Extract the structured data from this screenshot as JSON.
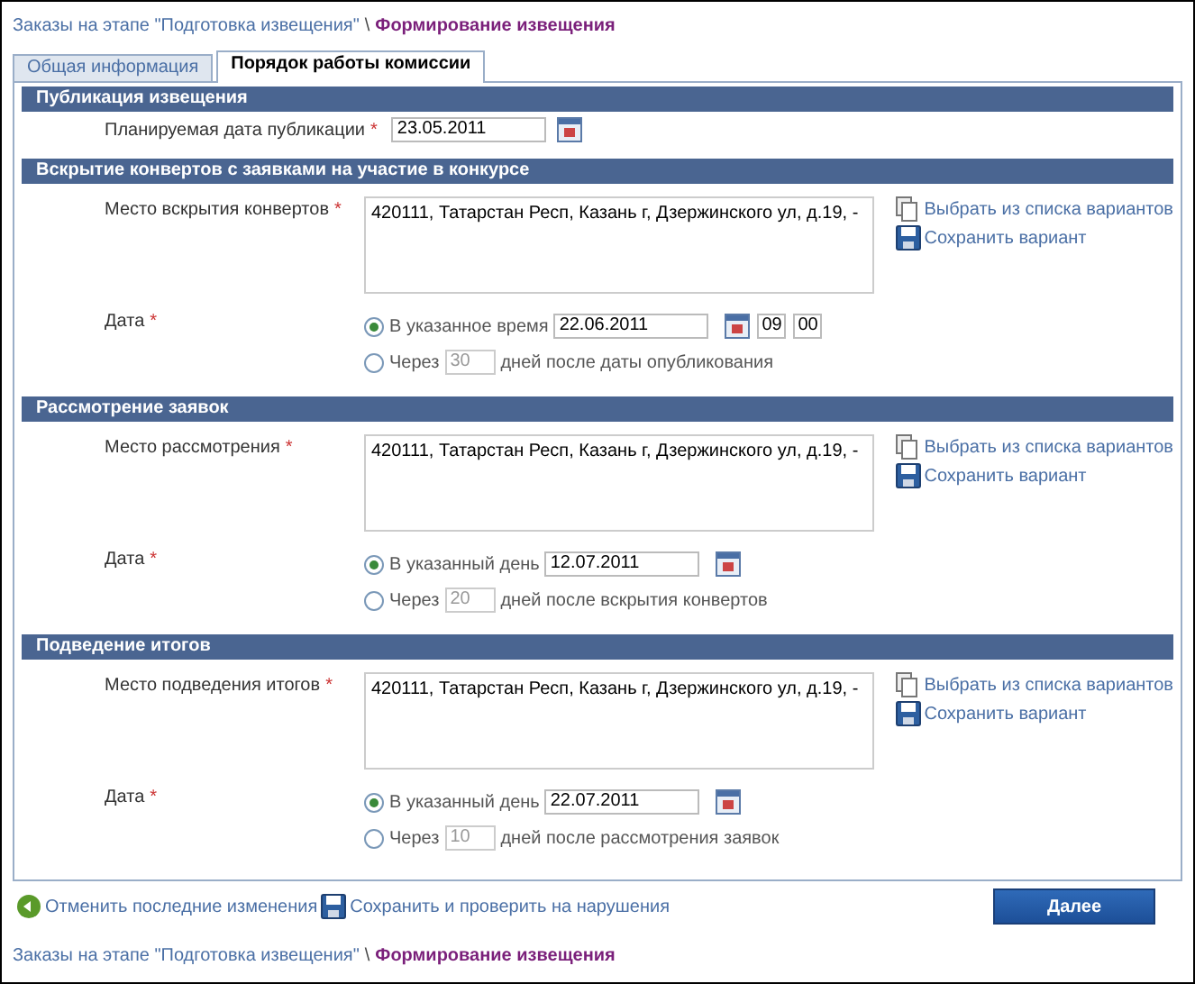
{
  "breadcrumb": {
    "link": "Заказы на этапе \"Подготовка извещения\"",
    "separator": "\\",
    "current": "Формирование извещения"
  },
  "tabs": [
    {
      "label": "Общая информация",
      "selected": false
    },
    {
      "label": "Порядок работы комиссии",
      "selected": true
    }
  ],
  "sections": [
    {
      "title": "Публикация извещения",
      "rows": [
        {
          "kind": "date",
          "label": "Планируемая дата публикации",
          "required_mark": "*",
          "value": "23.05.2011"
        }
      ]
    },
    {
      "title": "Вскрытие конвертов с заявками на участие в конкурсе",
      "rows": [
        {
          "kind": "place",
          "label": "Место вскрытия конвертов",
          "required_mark": "*",
          "value": "420111, Татарстан Респ, Казань г, Дзержинского ул, д.19, -",
          "links": [
            {
              "kind": "choose",
              "label": "Выбрать из списка вариантов"
            },
            {
              "kind": "save",
              "label": "Сохранить вариант"
            }
          ]
        },
        {
          "kind": "choice",
          "label": "Дата",
          "required_mark": "*",
          "options": [
            {
              "kind": "datetime",
              "selected": true,
              "label": "В указанное время",
              "value": "22.06.2011",
              "hour": "09",
              "minute": "00"
            },
            {
              "kind": "days",
              "selected": false,
              "label": "Через",
              "value": "30",
              "suffix": "дней после даты опубликования"
            }
          ]
        }
      ]
    },
    {
      "title": "Рассмотрение заявок",
      "rows": [
        {
          "kind": "place",
          "label": "Место рассмотрения",
          "required_mark": "*",
          "value": "420111, Татарстан Респ, Казань г, Дзержинского ул, д.19, -",
          "links": [
            {
              "kind": "choose",
              "label": "Выбрать из списка вариантов"
            },
            {
              "kind": "save",
              "label": "Сохранить вариант"
            }
          ]
        },
        {
          "kind": "choice",
          "label": "Дата",
          "required_mark": "*",
          "options": [
            {
              "kind": "date",
              "selected": true,
              "label": "В указанный день",
              "value": "12.07.2011"
            },
            {
              "kind": "days",
              "selected": false,
              "label": "Через",
              "value": "20",
              "suffix": "дней после вскрытия конвертов"
            }
          ]
        }
      ]
    },
    {
      "title": "Подведение итогов",
      "rows": [
        {
          "kind": "place",
          "label": "Место подведения итогов",
          "required_mark": "*",
          "value": "420111, Татарстан Респ, Казань г, Дзержинского ул, д.19, -",
          "links": [
            {
              "kind": "choose",
              "label": "Выбрать из списка вариантов"
            },
            {
              "kind": "save",
              "label": "Сохранить вариант"
            }
          ]
        },
        {
          "kind": "choice",
          "label": "Дата",
          "required_mark": "*",
          "options": [
            {
              "kind": "date",
              "selected": true,
              "label": "В указанный день",
              "value": "22.07.2011"
            },
            {
              "kind": "days",
              "selected": false,
              "label": "Через",
              "value": "10",
              "suffix": "дней после рассмотрения заявок"
            }
          ]
        }
      ]
    }
  ],
  "actions": [
    {
      "kind": "undo",
      "label": "Отменить последние изменения"
    },
    {
      "kind": "save",
      "label": "Сохранить и проверить на нарушения"
    }
  ],
  "next_button": "Далее",
  "footer_breadcrumb": {
    "link": "Заказы на этапе \"Подготовка извещения\"",
    "separator": "\\",
    "current": "Формирование извещения"
  }
}
